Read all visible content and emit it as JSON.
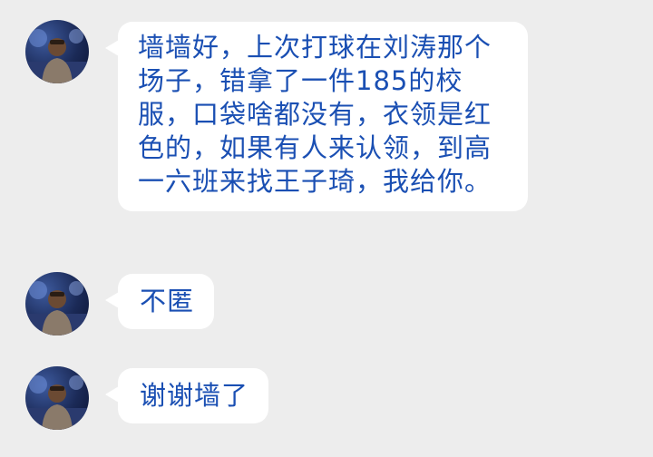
{
  "messages": [
    {
      "text": "墙墙好，上次打球在刘涛那个场子，错拿了一件185的校服，口袋啥都没有，衣领是红色的，如果有人来认领，到高一六班来找王子琦，我给你。"
    },
    {
      "text": "不匿"
    },
    {
      "text": "谢谢墙了"
    }
  ],
  "colors": {
    "background": "#ededed",
    "bubble": "#ffffff",
    "message_text": "#1a4fb3"
  }
}
